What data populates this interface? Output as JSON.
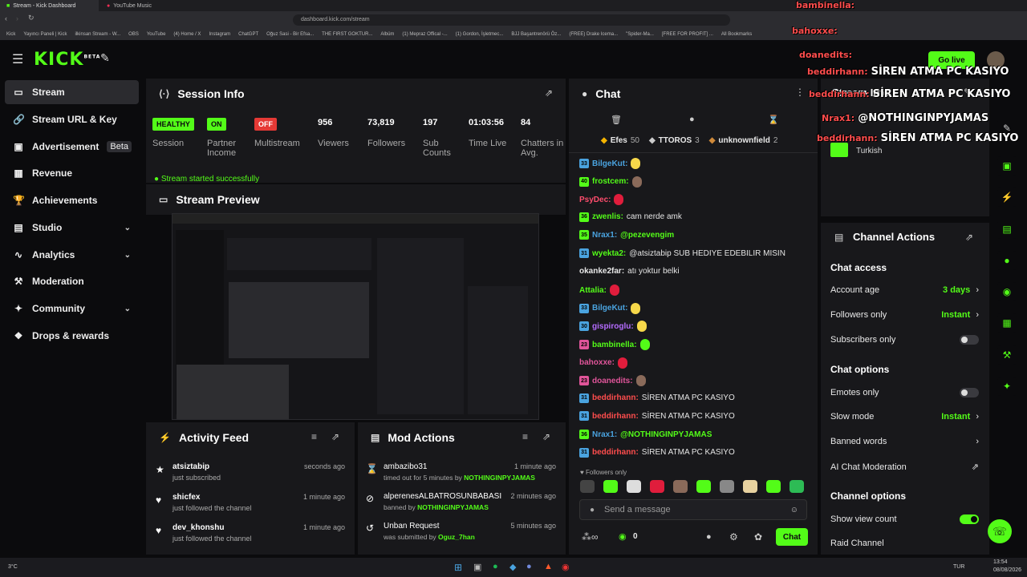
{
  "browser": {
    "tabs": [
      {
        "title": "Stream - Kick Dashboard",
        "active": true
      },
      {
        "title": "YouTube Music",
        "active": false
      }
    ],
    "url": "dashboard.kick.com/stream",
    "bookmarks": [
      "Kick",
      "Yayıncı Paneli | Kick",
      "ilkinsan Stream - W...",
      "OBS",
      "YouTube",
      "(4) Home / X",
      "Instagram",
      "ChatGPT",
      "Oğuz Sasi - Bir Efsa...",
      "THE FIRST GOKTUR...",
      "Albüm",
      "(1) Mepraz Offical -...",
      "(1) Gordon, İşletmec...",
      "BJJ Başantrenörü Öz...",
      "(FREE) Drake Icema...",
      "\"Spider-Ma...",
      "[FREE FOR PROFIT] ...",
      "All Bookmarks"
    ]
  },
  "header": {
    "logo": "KICK",
    "logo_sup": "BETA",
    "go_live": "Go live"
  },
  "sidebar": {
    "items": [
      {
        "label": "Stream",
        "icon": "stream-icon",
        "glyph": "▭"
      },
      {
        "label": "Stream URL & Key",
        "icon": "link-icon",
        "glyph": "🔗"
      },
      {
        "label": "Advertisement",
        "icon": "ad-icon",
        "glyph": "▣"
      },
      {
        "label": "Revenue",
        "icon": "revenue-icon",
        "glyph": "▦"
      },
      {
        "label": "Achievements",
        "icon": "trophy-icon",
        "glyph": "🏆"
      },
      {
        "label": "Studio",
        "icon": "studio-icon",
        "glyph": "▤"
      },
      {
        "label": "Analytics",
        "icon": "analytics-icon",
        "glyph": "∿"
      },
      {
        "label": "Moderation",
        "icon": "hammer-icon",
        "glyph": "⚒"
      },
      {
        "label": "Community",
        "icon": "community-icon",
        "glyph": "✦"
      },
      {
        "label": "Drops & rewards",
        "icon": "gift-icon",
        "glyph": "❖"
      }
    ],
    "beta_label": "Beta"
  },
  "session": {
    "title": "Session Info",
    "stats": [
      {
        "value": "HEALTHY",
        "label": "Session",
        "tag": true,
        "color": "#53fc18"
      },
      {
        "value": "ON",
        "label": "Partner Income",
        "tag": true,
        "color": "#53fc18"
      },
      {
        "value": "OFF",
        "label": "Multistream",
        "tag": true,
        "color": "#e53935"
      },
      {
        "value": "956",
        "label": "Viewers",
        "tag": false
      },
      {
        "value": "73,819",
        "label": "Followers",
        "tag": false
      },
      {
        "value": "197",
        "label": "Sub Counts",
        "tag": false
      },
      {
        "value": "01:03:56",
        "label": "Time Live",
        "tag": false
      },
      {
        "value": "84",
        "label": "Chatters in Avg.",
        "tag": false
      }
    ],
    "notice": "Stream started successfully"
  },
  "preview": {
    "title": "Stream Preview"
  },
  "activity": {
    "title": "Activity Feed",
    "items": [
      {
        "user": "atsiztabip",
        "action": "just subscribed",
        "time": "seconds ago",
        "icon": "star-icon",
        "glyph": "★"
      },
      {
        "user": "shicfex",
        "action": "just followed the channel",
        "time": "1 minute ago",
        "icon": "heart-icon",
        "glyph": "♥"
      },
      {
        "user": "dev_khonshu",
        "action": "just followed the channel",
        "time": "1 minute ago",
        "icon": "heart-icon",
        "glyph": "♥"
      }
    ]
  },
  "mod": {
    "title": "Mod Actions",
    "items": [
      {
        "title": "ambazibo31",
        "pre": "timed out for 5 minutes by ",
        "by": "NOTHINGINPYJAMAS",
        "time": "1 minute ago",
        "icon": "hourglass-icon",
        "glyph": "⌛"
      },
      {
        "title": "alperenesALBATROSUNBABASI",
        "pre": "banned by ",
        "by": "NOTHINGINPYJAMAS",
        "time": "2 minutes ago",
        "icon": "ban-icon",
        "glyph": "⊘"
      },
      {
        "title": "Unban Request",
        "pre": "was submitted by ",
        "by": "Oguz_7han",
        "time": "5 minutes ago",
        "icon": "history-icon",
        "glyph": "↺"
      }
    ]
  },
  "chat": {
    "title": "Chat",
    "top_gifters": [
      {
        "name": "Efes",
        "count": "50",
        "color": "#f5b400"
      },
      {
        "name": "TTOROS",
        "count": "3",
        "color": "#cccccc"
      },
      {
        "name": "unknownfield",
        "count": "2",
        "color": "#d08a3a"
      }
    ],
    "messages": [
      {
        "badge": "33",
        "bcolor": "#4aa3df",
        "user": "BilgeKut",
        "ucolor": "#4aa3df",
        "text": "",
        "emote": "#f7d84a"
      },
      {
        "badge": "40",
        "bcolor": "#53fc18",
        "user": "frostcem",
        "ucolor": "#53fc18",
        "text": "",
        "emote": "#8a6a5a"
      },
      {
        "badge": "",
        "bcolor": "",
        "user": "PsyDec",
        "ucolor": "#ff4d6d",
        "text": "",
        "emote": "#e01d3c"
      },
      {
        "badge": "36",
        "bcolor": "#53fc18",
        "user": "zwenlis",
        "ucolor": "#53fc18",
        "text": "cam nerde amk",
        "emote": ""
      },
      {
        "badge": "35",
        "bcolor": "#53fc18",
        "user": "Nrax1",
        "ucolor": "#4aa3df",
        "text": "@pezevengim",
        "emote": "",
        "mention": true
      },
      {
        "badge": "31",
        "bcolor": "#4aa3df",
        "user": "wyekta2",
        "ucolor": "#53fc18",
        "text": "@atsiztabip SUB HEDIYE EDEBILIR MISIN",
        "emote": ""
      },
      {
        "badge": "",
        "bcolor": "",
        "user": "okanke2far",
        "ucolor": "#e8e8e8",
        "text": "atı yoktur belki",
        "emote": ""
      },
      {
        "badge": "",
        "bcolor": "",
        "user": "Attalia",
        "ucolor": "#53fc18",
        "text": "",
        "emote": "#e01d3c"
      },
      {
        "badge": "33",
        "bcolor": "#4aa3df",
        "user": "BilgeKut",
        "ucolor": "#4aa3df",
        "text": "",
        "emote": "#f7d84a"
      },
      {
        "badge": "30",
        "bcolor": "#4aa3df",
        "user": "gispiroglu",
        "ucolor": "#b56cff",
        "text": "",
        "emote": "#f7d84a"
      },
      {
        "badge": "23",
        "bcolor": "#e0559a",
        "user": "bambinella",
        "ucolor": "#53fc18",
        "text": "",
        "emote": "#53fc18"
      },
      {
        "badge": "",
        "bcolor": "",
        "user": "bahoxxe",
        "ucolor": "#e0559a",
        "text": "",
        "emote": "#e01d3c"
      },
      {
        "badge": "23",
        "bcolor": "#e0559a",
        "user": "doanedits",
        "ucolor": "#e0559a",
        "text": "",
        "emote": "#8a6a5a"
      },
      {
        "badge": "31",
        "bcolor": "#4aa3df",
        "user": "beddirhann",
        "ucolor": "#ff4d4d",
        "text": "SİREN ATMA PC KASIYO",
        "emote": ""
      },
      {
        "badge": "31",
        "bcolor": "#4aa3df",
        "user": "beddirhann",
        "ucolor": "#ff4d4d",
        "text": "SİREN ATMA PC KASIYO",
        "emote": ""
      },
      {
        "badge": "36",
        "bcolor": "#53fc18",
        "user": "Nrax1",
        "ucolor": "#4aa3df",
        "text": "@NOTHINGINPYJAMAS",
        "emote": "",
        "mention": true
      },
      {
        "badge": "31",
        "bcolor": "#4aa3df",
        "user": "beddirhann",
        "ucolor": "#ff4d4d",
        "text": "SİREN ATMA PC KASIYO",
        "emote": ""
      }
    ],
    "followers_only": "Followers only",
    "placeholder": "Send a message",
    "points": "0",
    "send_label": "Chat"
  },
  "channel_actions": {
    "title": "Channel Actions",
    "chat_access": "Chat access",
    "account_age": {
      "label": "Account age",
      "value": "3 days"
    },
    "followers_only": {
      "label": "Followers only",
      "value": "Instant"
    },
    "subscribers_only": {
      "label": "Subscribers only"
    },
    "chat_options": "Chat options",
    "emotes_only": {
      "label": "Emotes only"
    },
    "slow_mode": {
      "label": "Slow mode",
      "value": "Instant"
    },
    "banned_words": {
      "label": "Banned words"
    },
    "ai_moderation": {
      "label": "AI Chat Moderation"
    },
    "channel_options": "Channel options",
    "show_view_count": {
      "label": "Show view count"
    },
    "raid_channel": {
      "label": "Raid Channel"
    }
  },
  "stream_info": {
    "title": "Stream Info",
    "language": "Turkish"
  },
  "overlay": {
    "lines": [
      {
        "user": "bambinella:",
        "text": ""
      },
      {
        "user": "bahoxxe:",
        "text": ""
      },
      {
        "user": "doanedits:",
        "text": ""
      },
      {
        "user": "beddirhann:",
        "text": "SİREN ATMA PC KASIYO"
      },
      {
        "user": "beddirhann:",
        "text": "SİREN ATMA PC KASIYO"
      },
      {
        "user": "Nrax1:",
        "text": "@NOTHINGINPYJAMAS"
      },
      {
        "user": "beddirhann:",
        "text": "SİREN ATMA PC KASIYO"
      }
    ]
  },
  "taskbar": {
    "temp": "3°C",
    "lang": "TUR",
    "time": "13:54",
    "date": "08/08/2026"
  }
}
